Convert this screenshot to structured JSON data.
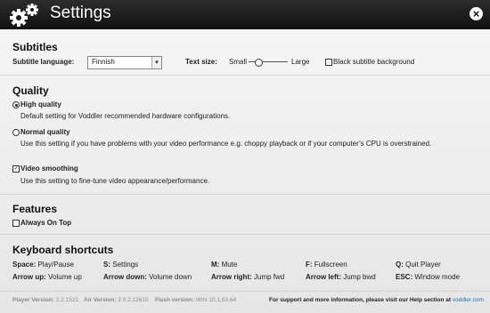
{
  "window": {
    "title": "Settings"
  },
  "subtitles": {
    "heading": "Subtitles",
    "language_label": "Subtitle language:",
    "language_value": "Finnish",
    "text_size_label": "Text size:",
    "size_small": "Small",
    "size_large": "Large",
    "size_level": 0.2,
    "background_label": "Black subtitle background",
    "background_checked": false
  },
  "quality": {
    "heading": "Quality",
    "high_label": "High quality",
    "high_desc": "Default setting for Voddler recommended hardware configurations.",
    "normal_label": "Normal quality",
    "normal_desc": "Use this setting if you have problems with your video performance e.g. choppy playback or if your computer’s CPU is overstrained.",
    "smoothing_label": "Video smoothing",
    "smoothing_desc": "Use this setting to fine-tune video appearance/performance.",
    "selected": "high",
    "smoothing_checked": true
  },
  "features": {
    "heading": "Features",
    "always_on_top_label": "Always On Top",
    "always_on_top_checked": false
  },
  "shortcuts": {
    "heading": "Keyboard shortcuts",
    "items": [
      {
        "key": "Space:",
        "action": "Play/Pause"
      },
      {
        "key": "S:",
        "action": "Settings"
      },
      {
        "key": "M:",
        "action": "Mute"
      },
      {
        "key": "F:",
        "action": "Fullscreen"
      },
      {
        "key": "Q:",
        "action": "Quit Player"
      },
      {
        "key": "Arrow up:",
        "action": "Volume up"
      },
      {
        "key": "Arrow down:",
        "action": "Volume down"
      },
      {
        "key": "Arrow right:",
        "action": "Jump fwd"
      },
      {
        "key": "Arrow left:",
        "action": "Jump bwd"
      },
      {
        "key": "ESC:",
        "action": "Window mode"
      }
    ]
  },
  "footer": {
    "player_version_label": "Player Version:",
    "player_version": "2.2.1521",
    "air_version_label": "Air Version:",
    "air_version": "2.0.2.12610",
    "flash_version_label": "Flash version:",
    "flash_version": "WIN 10,1,53,64",
    "support_text": "For support and more information, please visit our Help section at",
    "support_link": "voddler.com"
  }
}
